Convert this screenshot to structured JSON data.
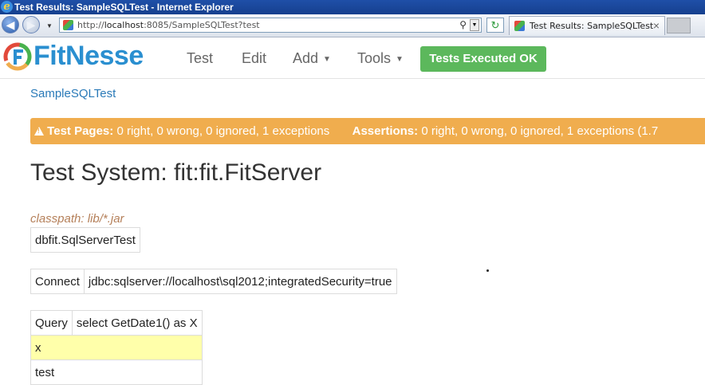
{
  "window": {
    "title": "Test Results: SampleSQLTest - Internet Explorer"
  },
  "browser": {
    "url_prefix": "http://",
    "url_host": "localhost",
    "url_rest": ":8085/SampleSQLTest?test",
    "tab_title": "Test Results: SampleSQLTest",
    "icons": [
      "back-arrow-icon",
      "forward-arrow-icon",
      "search-icon",
      "refresh-icon",
      "close-icon"
    ]
  },
  "header": {
    "logo_text": "FitNesse",
    "menu": {
      "test": "Test",
      "edit": "Edit",
      "add": "Add",
      "tools": "Tools"
    },
    "status_badge": "Tests Executed OK",
    "colors": {
      "brand": "#2a8fd0",
      "badge": "#5cb85c",
      "summary": "#f0ad4e"
    }
  },
  "main": {
    "breadcrumb": "SampleSQLTest",
    "summary": {
      "pages_label": "Test Pages:",
      "pages_text": "0 right, 0 wrong, 0 ignored, 1 exceptions",
      "assertions_label": "Assertions:",
      "assertions_text": "0 right, 0 wrong, 0 ignored, 1 exceptions (1.7"
    },
    "system_title": "Test System: fit:fit.FitServer",
    "classpath": "classpath: lib/*.jar",
    "tables": {
      "fixture": "dbfit.SqlServerTest",
      "connect_label": "Connect",
      "connect_value": "jdbc:sqlserver://localhost\\sql2012;integratedSecurity=true",
      "query_label": "Query",
      "query_value": "select GetDate1() as X",
      "column_header": "x",
      "row_value": "test"
    }
  }
}
